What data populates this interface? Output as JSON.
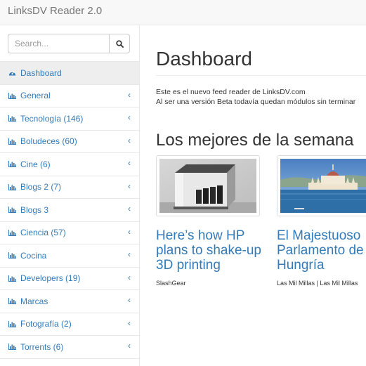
{
  "app": {
    "brand": "LinksDV Reader 2.0"
  },
  "search": {
    "placeholder": "Search...",
    "icon": "search-icon"
  },
  "sidebar": {
    "items": [
      {
        "label": "Dashboard",
        "icon": "dashboard-icon",
        "active": true,
        "has_chevron": false
      },
      {
        "label": "General",
        "icon": "bar-chart-icon",
        "has_chevron": true
      },
      {
        "label": "Tecnología (146)",
        "icon": "bar-chart-icon",
        "has_chevron": true
      },
      {
        "label": "Boludeces (60)",
        "icon": "bar-chart-icon",
        "has_chevron": true
      },
      {
        "label": "Cine (6)",
        "icon": "bar-chart-icon",
        "has_chevron": true
      },
      {
        "label": "Blogs 2 (7)",
        "icon": "bar-chart-icon",
        "has_chevron": true
      },
      {
        "label": "Blogs 3",
        "icon": "bar-chart-icon",
        "has_chevron": true
      },
      {
        "label": "Ciencia (57)",
        "icon": "bar-chart-icon",
        "has_chevron": true
      },
      {
        "label": "Cocina",
        "icon": "bar-chart-icon",
        "has_chevron": true
      },
      {
        "label": "Developers (19)",
        "icon": "bar-chart-icon",
        "has_chevron": true
      },
      {
        "label": "Marcas",
        "icon": "bar-chart-icon",
        "has_chevron": true
      },
      {
        "label": "Fotografía (2)",
        "icon": "bar-chart-icon",
        "has_chevron": true
      },
      {
        "label": "Torrents (6)",
        "icon": "bar-chart-icon",
        "has_chevron": true
      }
    ],
    "chevron": "‹"
  },
  "main": {
    "title": "Dashboard",
    "intro_line1": "Este es el nuevo feed reader de LinksDV.com",
    "intro_line2": "Al ser una versión Beta todavía quedan módulos sin terminar",
    "section_title": "Los mejores de la semana",
    "cards": [
      {
        "title_line1": "Here’s how HP",
        "title_line2": "plans to shake-up",
        "title_line3": "3D printing",
        "source": "SlashGear"
      },
      {
        "title_line1": "El Majestuoso",
        "title_line2": "Parlamento de",
        "title_line3": "Hungría",
        "source": "Las Mil Millas | Las Mil Millas"
      }
    ]
  },
  "colors": {
    "link": "#337ab7",
    "navbar_bg": "#f8f8f8",
    "border": "#e7e7e7",
    "active_bg": "#eeeeee"
  }
}
